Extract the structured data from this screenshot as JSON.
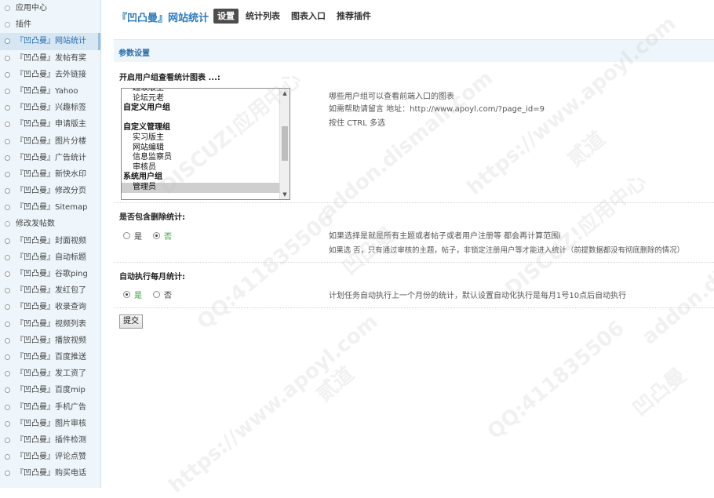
{
  "sidebar": {
    "items": [
      {
        "label": "应用中心",
        "kind": "plain"
      },
      {
        "label": "插件",
        "kind": "plain"
      },
      {
        "label": "『凹凸曼』网站统计",
        "kind": "sub",
        "active": true
      },
      {
        "label": "『凹凸曼』发帖有奖",
        "kind": "sub"
      },
      {
        "label": "『凹凸曼』去外链接",
        "kind": "sub"
      },
      {
        "label": "『凹凸曼』Yahoo",
        "kind": "sub"
      },
      {
        "label": "『凹凸曼』兴趣标签",
        "kind": "sub"
      },
      {
        "label": "『凹凸曼』申请版主",
        "kind": "sub"
      },
      {
        "label": "『凹凸曼』图片分楼",
        "kind": "sub"
      },
      {
        "label": "『凹凸曼』广告统计",
        "kind": "sub"
      },
      {
        "label": "『凹凸曼』新快水印",
        "kind": "sub"
      },
      {
        "label": "『凹凸曼』修改分页",
        "kind": "sub"
      },
      {
        "label": "『凹凸曼』Sitemap",
        "kind": "sub"
      },
      {
        "label": "修改发帖数",
        "kind": "plain"
      },
      {
        "label": "『凹凸曼』封面视频",
        "kind": "sub"
      },
      {
        "label": "『凹凸曼』自动标题",
        "kind": "sub"
      },
      {
        "label": "『凹凸曼』谷歌ping",
        "kind": "sub"
      },
      {
        "label": "『凹凸曼』发红包了",
        "kind": "sub"
      },
      {
        "label": "『凹凸曼』收录查询",
        "kind": "sub"
      },
      {
        "label": "『凹凸曼』视频列表",
        "kind": "sub"
      },
      {
        "label": "『凹凸曼』播放视频",
        "kind": "sub"
      },
      {
        "label": "『凹凸曼』百度推送",
        "kind": "sub"
      },
      {
        "label": "『凹凸曼』发工资了",
        "kind": "sub"
      },
      {
        "label": "『凹凸曼』百度mip",
        "kind": "sub"
      },
      {
        "label": "『凹凸曼』手机广告",
        "kind": "sub"
      },
      {
        "label": "『凹凸曼』图片审核",
        "kind": "sub"
      },
      {
        "label": "『凹凸曼』插件检测",
        "kind": "sub"
      },
      {
        "label": "『凹凸曼』评论点赞",
        "kind": "sub"
      },
      {
        "label": "『凹凸曼』购买电话",
        "kind": "sub"
      }
    ]
  },
  "header": {
    "title": "『凹凸曼』网站统计",
    "tabs": [
      "设置",
      "统计列表",
      "图表入口",
      "推荐插件"
    ]
  },
  "section": {
    "title": "参数设置"
  },
  "setting_groups": {
    "label": "开启用户组查看统计图表 ...:",
    "options": [
      {
        "text": "超级版主",
        "kind": "item"
      },
      {
        "text": "论坛元老",
        "kind": "item"
      },
      {
        "text": "自定义用户组",
        "kind": "group"
      },
      {
        "text": "",
        "kind": "blank"
      },
      {
        "text": "自定义管理组",
        "kind": "group"
      },
      {
        "text": "实习版主",
        "kind": "item"
      },
      {
        "text": "网站编辑",
        "kind": "item"
      },
      {
        "text": "信息监察员",
        "kind": "item"
      },
      {
        "text": "审核员",
        "kind": "item"
      },
      {
        "text": "系统用户组",
        "kind": "group"
      },
      {
        "text": "管理员",
        "kind": "item",
        "selected": true
      }
    ],
    "hints": [
      "哪些用户组可以查看前端入口的图表",
      "如需帮助请留言 地址：http://www.apoyl.com/?page_id=9",
      "按住 CTRL 多选"
    ]
  },
  "setting_deleted": {
    "label": "是否包含删除统计:",
    "yes": "是",
    "no": "否",
    "selected": "no",
    "hints": [
      "如果选择是就是所有主题或者帖子或者用户注册等 都会再计算范围i",
      "如果选 否，只有通过审核的主题，帖子，非锁定注册用户等才能进入统计（前提数据都没有彻底删除的情况）"
    ]
  },
  "setting_monthly": {
    "label": "自动执行每月统计:",
    "yes": "是",
    "no": "否",
    "selected": "yes",
    "hints": [
      "计划任务自动执行上一个月份的统计，默认设置自动化执行是每月1号10点后自动执行"
    ]
  },
  "submit_label": "提交",
  "watermarks": [
    "DISCUZ!应用中心",
    "addon.dismall.com",
    "https://www.apoyl.com",
    "贰道",
    "QQ:411835506",
    "凹凸曼"
  ]
}
